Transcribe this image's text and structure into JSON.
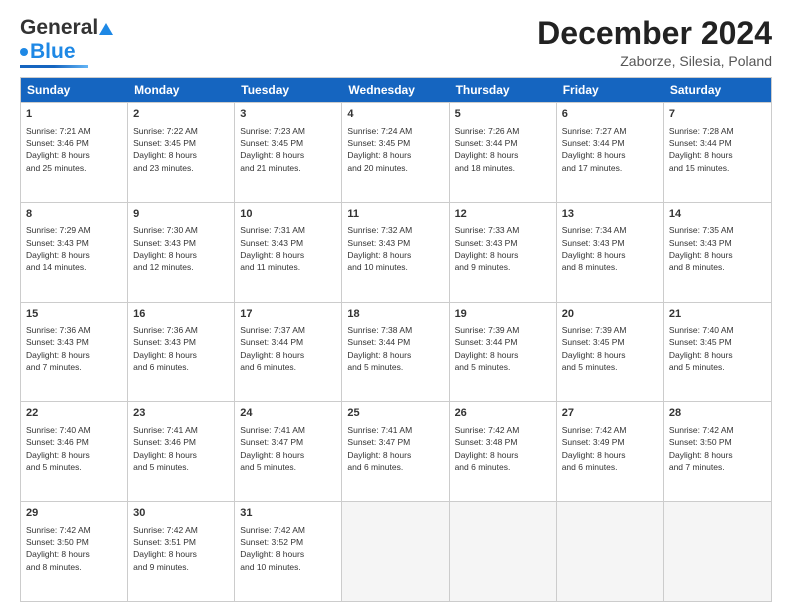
{
  "header": {
    "logo_general": "General",
    "logo_blue": "Blue",
    "main_title": "December 2024",
    "subtitle": "Zaborze, Silesia, Poland"
  },
  "calendar": {
    "days_of_week": [
      "Sunday",
      "Monday",
      "Tuesday",
      "Wednesday",
      "Thursday",
      "Friday",
      "Saturday"
    ],
    "weeks": [
      [
        {
          "day": "",
          "info": ""
        },
        {
          "day": "2",
          "info": "Sunrise: 7:22 AM\nSunset: 3:45 PM\nDaylight: 8 hours\nand 23 minutes."
        },
        {
          "day": "3",
          "info": "Sunrise: 7:23 AM\nSunset: 3:45 PM\nDaylight: 8 hours\nand 21 minutes."
        },
        {
          "day": "4",
          "info": "Sunrise: 7:24 AM\nSunset: 3:45 PM\nDaylight: 8 hours\nand 20 minutes."
        },
        {
          "day": "5",
          "info": "Sunrise: 7:26 AM\nSunset: 3:44 PM\nDaylight: 8 hours\nand 18 minutes."
        },
        {
          "day": "6",
          "info": "Sunrise: 7:27 AM\nSunset: 3:44 PM\nDaylight: 8 hours\nand 17 minutes."
        },
        {
          "day": "7",
          "info": "Sunrise: 7:28 AM\nSunset: 3:44 PM\nDaylight: 8 hours\nand 15 minutes."
        }
      ],
      [
        {
          "day": "8",
          "info": "Sunrise: 7:29 AM\nSunset: 3:43 PM\nDaylight: 8 hours\nand 14 minutes."
        },
        {
          "day": "9",
          "info": "Sunrise: 7:30 AM\nSunset: 3:43 PM\nDaylight: 8 hours\nand 12 minutes."
        },
        {
          "day": "10",
          "info": "Sunrise: 7:31 AM\nSunset: 3:43 PM\nDaylight: 8 hours\nand 11 minutes."
        },
        {
          "day": "11",
          "info": "Sunrise: 7:32 AM\nSunset: 3:43 PM\nDaylight: 8 hours\nand 10 minutes."
        },
        {
          "day": "12",
          "info": "Sunrise: 7:33 AM\nSunset: 3:43 PM\nDaylight: 8 hours\nand 9 minutes."
        },
        {
          "day": "13",
          "info": "Sunrise: 7:34 AM\nSunset: 3:43 PM\nDaylight: 8 hours\nand 8 minutes."
        },
        {
          "day": "14",
          "info": "Sunrise: 7:35 AM\nSunset: 3:43 PM\nDaylight: 8 hours\nand 8 minutes."
        }
      ],
      [
        {
          "day": "15",
          "info": "Sunrise: 7:36 AM\nSunset: 3:43 PM\nDaylight: 8 hours\nand 7 minutes."
        },
        {
          "day": "16",
          "info": "Sunrise: 7:36 AM\nSunset: 3:43 PM\nDaylight: 8 hours\nand 6 minutes."
        },
        {
          "day": "17",
          "info": "Sunrise: 7:37 AM\nSunset: 3:44 PM\nDaylight: 8 hours\nand 6 minutes."
        },
        {
          "day": "18",
          "info": "Sunrise: 7:38 AM\nSunset: 3:44 PM\nDaylight: 8 hours\nand 5 minutes."
        },
        {
          "day": "19",
          "info": "Sunrise: 7:39 AM\nSunset: 3:44 PM\nDaylight: 8 hours\nand 5 minutes."
        },
        {
          "day": "20",
          "info": "Sunrise: 7:39 AM\nSunset: 3:45 PM\nDaylight: 8 hours\nand 5 minutes."
        },
        {
          "day": "21",
          "info": "Sunrise: 7:40 AM\nSunset: 3:45 PM\nDaylight: 8 hours\nand 5 minutes."
        }
      ],
      [
        {
          "day": "22",
          "info": "Sunrise: 7:40 AM\nSunset: 3:46 PM\nDaylight: 8 hours\nand 5 minutes."
        },
        {
          "day": "23",
          "info": "Sunrise: 7:41 AM\nSunset: 3:46 PM\nDaylight: 8 hours\nand 5 minutes."
        },
        {
          "day": "24",
          "info": "Sunrise: 7:41 AM\nSunset: 3:47 PM\nDaylight: 8 hours\nand 5 minutes."
        },
        {
          "day": "25",
          "info": "Sunrise: 7:41 AM\nSunset: 3:47 PM\nDaylight: 8 hours\nand 6 minutes."
        },
        {
          "day": "26",
          "info": "Sunrise: 7:42 AM\nSunset: 3:48 PM\nDaylight: 8 hours\nand 6 minutes."
        },
        {
          "day": "27",
          "info": "Sunrise: 7:42 AM\nSunset: 3:49 PM\nDaylight: 8 hours\nand 6 minutes."
        },
        {
          "day": "28",
          "info": "Sunrise: 7:42 AM\nSunset: 3:50 PM\nDaylight: 8 hours\nand 7 minutes."
        }
      ],
      [
        {
          "day": "29",
          "info": "Sunrise: 7:42 AM\nSunset: 3:50 PM\nDaylight: 8 hours\nand 8 minutes."
        },
        {
          "day": "30",
          "info": "Sunrise: 7:42 AM\nSunset: 3:51 PM\nDaylight: 8 hours\nand 9 minutes."
        },
        {
          "day": "31",
          "info": "Sunrise: 7:42 AM\nSunset: 3:52 PM\nDaylight: 8 hours\nand 10 minutes."
        },
        {
          "day": "",
          "info": ""
        },
        {
          "day": "",
          "info": ""
        },
        {
          "day": "",
          "info": ""
        },
        {
          "day": "",
          "info": ""
        }
      ]
    ],
    "first_week_day1": {
      "day": "1",
      "info": "Sunrise: 7:21 AM\nSunset: 3:46 PM\nDaylight: 8 hours\nand 25 minutes."
    }
  }
}
